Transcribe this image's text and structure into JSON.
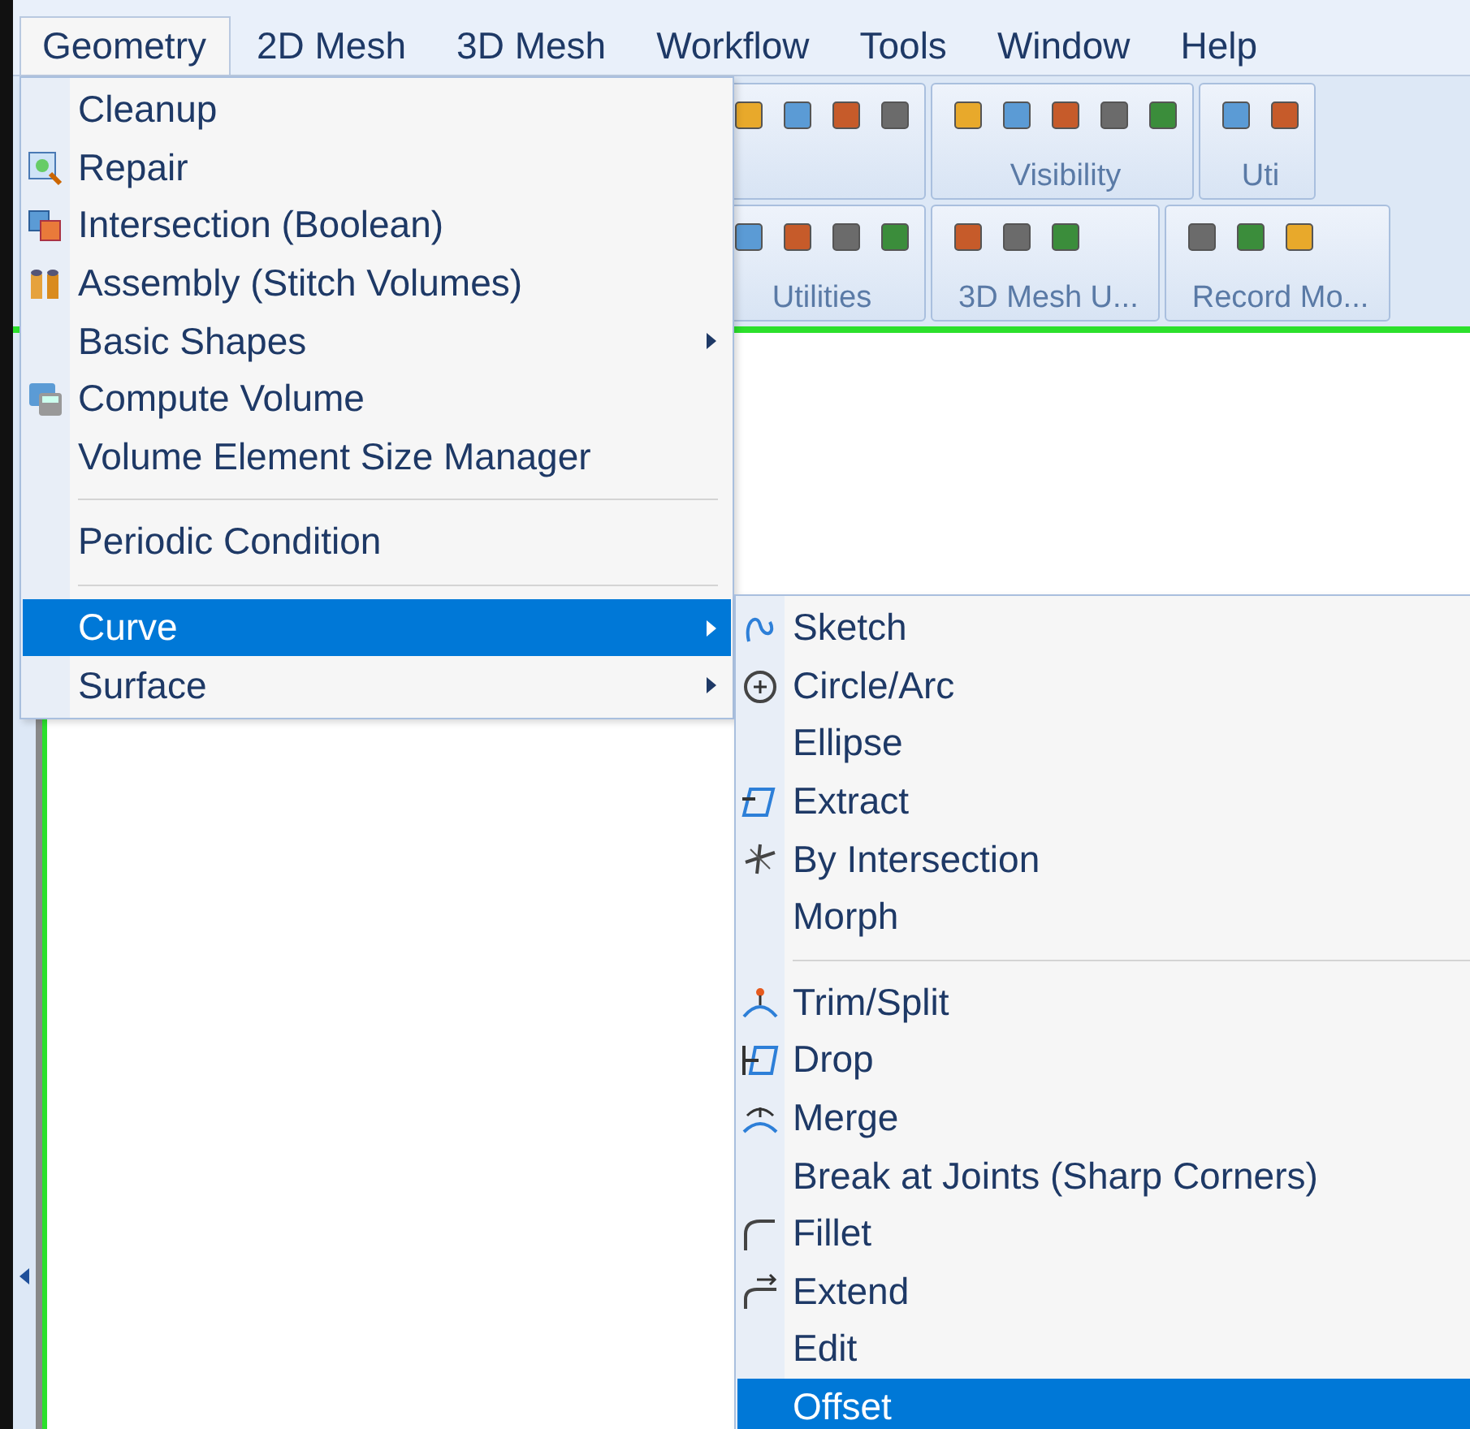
{
  "menubar": [
    {
      "label": "Geometry",
      "selected": true
    },
    {
      "label": "2D Mesh",
      "selected": false
    },
    {
      "label": "3D Mesh",
      "selected": false
    },
    {
      "label": "Workflow",
      "selected": false
    },
    {
      "label": "Tools",
      "selected": false
    },
    {
      "label": "Window",
      "selected": false
    },
    {
      "label": "Help",
      "selected": false
    }
  ],
  "toolbar_rows": [
    {
      "groups": [
        {
          "label": "Visibility"
        },
        {
          "label": "Uti"
        }
      ]
    },
    {
      "groups": [
        {
          "label": "Utilities"
        },
        {
          "label": "3D Mesh U..."
        },
        {
          "label": "Record Mo..."
        }
      ]
    }
  ],
  "geometry_menu": [
    {
      "kind": "item",
      "label": "Cleanup",
      "submenu": false,
      "selected": false
    },
    {
      "kind": "item",
      "label": "Repair",
      "submenu": false,
      "selected": false
    },
    {
      "kind": "item",
      "label": "Intersection (Boolean)",
      "submenu": false,
      "selected": false
    },
    {
      "kind": "item",
      "label": "Assembly (Stitch Volumes)",
      "submenu": false,
      "selected": false
    },
    {
      "kind": "item",
      "label": "Basic Shapes",
      "submenu": true,
      "selected": false
    },
    {
      "kind": "item",
      "label": "Compute Volume",
      "submenu": false,
      "selected": false
    },
    {
      "kind": "item",
      "label": "Volume Element Size Manager",
      "submenu": false,
      "selected": false
    },
    {
      "kind": "separator"
    },
    {
      "kind": "item",
      "label": "Periodic Condition",
      "submenu": false,
      "selected": false
    },
    {
      "kind": "separator"
    },
    {
      "kind": "item",
      "label": "Curve",
      "submenu": true,
      "selected": true
    },
    {
      "kind": "item",
      "label": "Surface",
      "submenu": true,
      "selected": false
    }
  ],
  "curve_submenu": [
    {
      "kind": "item",
      "label": "Sketch",
      "selected": false
    },
    {
      "kind": "item",
      "label": "Circle/Arc",
      "selected": false
    },
    {
      "kind": "item",
      "label": "Ellipse",
      "selected": false
    },
    {
      "kind": "item",
      "label": "Extract",
      "selected": false
    },
    {
      "kind": "item",
      "label": "By Intersection",
      "selected": false
    },
    {
      "kind": "item",
      "label": "Morph",
      "selected": false
    },
    {
      "kind": "separator"
    },
    {
      "kind": "item",
      "label": "Trim/Split",
      "selected": false
    },
    {
      "kind": "item",
      "label": "Drop",
      "selected": false
    },
    {
      "kind": "item",
      "label": "Merge",
      "selected": false
    },
    {
      "kind": "item",
      "label": "Break at Joints (Sharp Corners)",
      "selected": false
    },
    {
      "kind": "item",
      "label": "Fillet",
      "selected": false
    },
    {
      "kind": "item",
      "label": "Extend",
      "selected": false
    },
    {
      "kind": "item",
      "label": "Edit",
      "selected": false
    },
    {
      "kind": "item",
      "label": "Offset",
      "selected": true
    }
  ]
}
